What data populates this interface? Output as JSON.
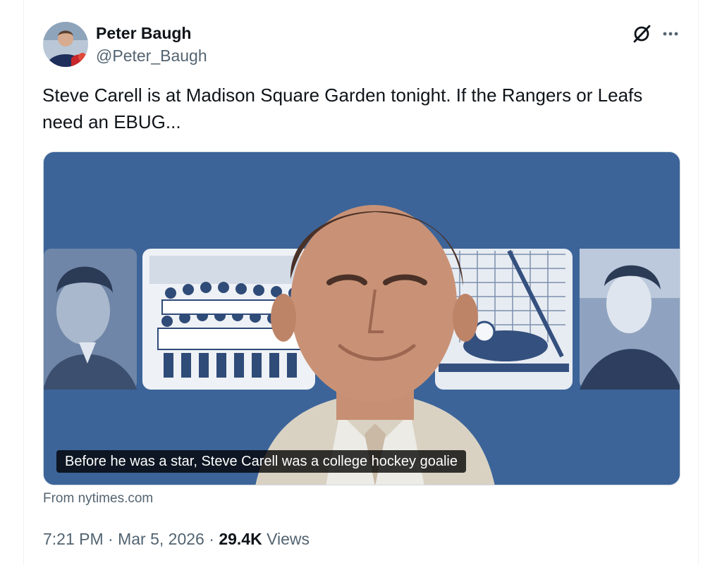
{
  "author": {
    "name": "Peter Baugh",
    "handle": "@Peter_Baugh"
  },
  "tweet": {
    "text": "Steve Carell is at Madison Square Garden tonight. If the Rangers or Leafs need an EBUG..."
  },
  "media": {
    "caption": "Before he was a star, Steve Carell was a college hockey goalie",
    "source": "From nytimes.com"
  },
  "meta": {
    "time": "7:21 PM",
    "separator": "·",
    "date": "Mar 5, 2026",
    "views_count": "29.4K",
    "views_label": "Views"
  },
  "icons": {
    "grok": "grok-icon",
    "more": "more-icon"
  },
  "colors": {
    "text_primary": "#0f1419",
    "text_secondary": "#536471",
    "media_background": "#3c6499"
  }
}
